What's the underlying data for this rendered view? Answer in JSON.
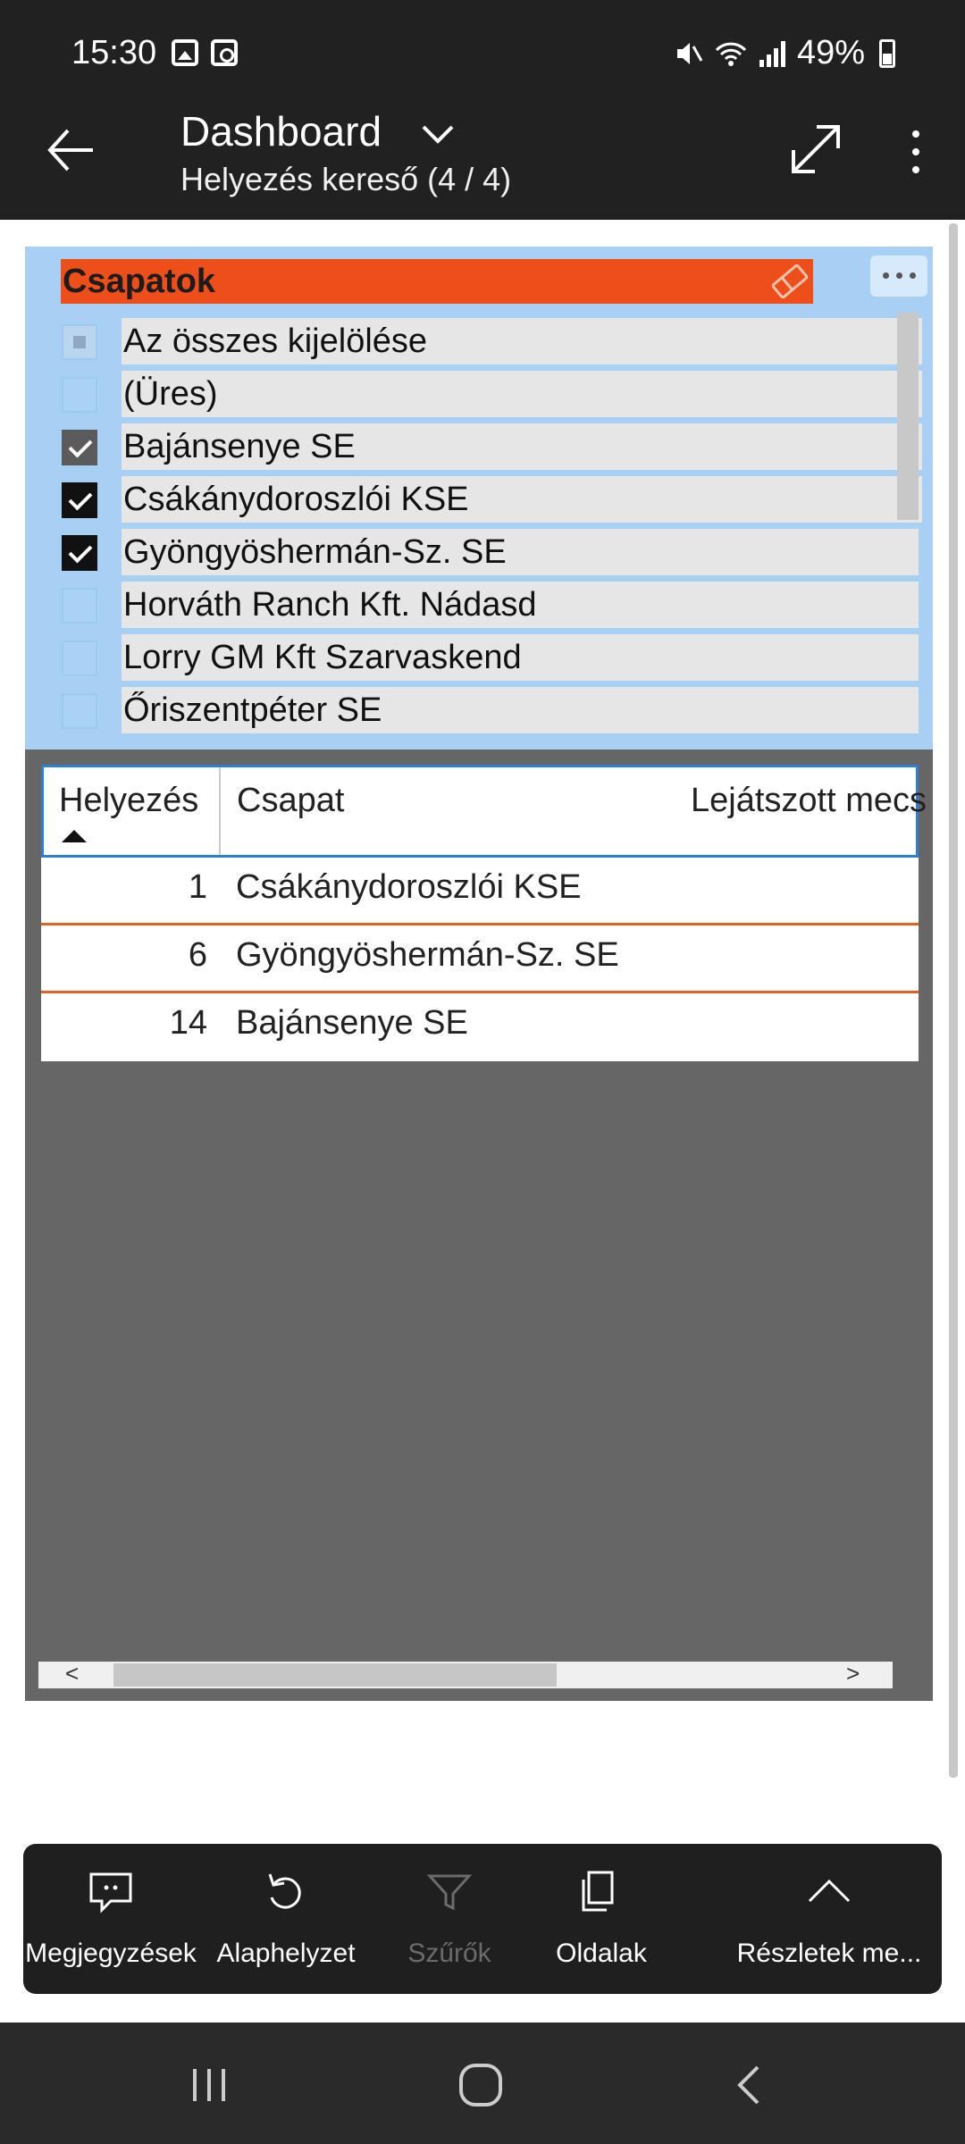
{
  "status_bar": {
    "time": "15:30",
    "battery": "49%",
    "icons": [
      "image-icon",
      "screenshot-icon",
      "mute-icon",
      "wifi-icon",
      "signal-icon",
      "battery-icon"
    ]
  },
  "app_bar": {
    "title": "Dashboard",
    "subtitle": "Helyezés kereső (4 / 4)"
  },
  "slicer": {
    "title": "Csapatok",
    "items": [
      {
        "label": "Az összes kijelölése",
        "state": "partial"
      },
      {
        "label": "(Üres)",
        "state": "unchecked"
      },
      {
        "label": "Bajánsenye SE",
        "state": "checked"
      },
      {
        "label": "Csákánydoroszlói KSE",
        "state": "checked"
      },
      {
        "label": "Gyöngyöshermán-Sz. SE",
        "state": "checked"
      },
      {
        "label": "Horváth Ranch Kft. Nádasd",
        "state": "unchecked"
      },
      {
        "label": "Lorry GM Kft Szarvaskend",
        "state": "unchecked"
      },
      {
        "label": "Őriszentpéter SE",
        "state": "unchecked"
      }
    ]
  },
  "table": {
    "columns": [
      "Helyezés",
      "Csapat",
      "Lejátszott mecs"
    ],
    "rows": [
      {
        "rank": "1",
        "team": "Csákánydoroszlói KSE"
      },
      {
        "rank": "6",
        "team": "Gyöngyöshermán-Sz. SE"
      },
      {
        "rank": "14",
        "team": "Bajánsenye SE"
      }
    ]
  },
  "toolbar": {
    "buttons": [
      {
        "label": "Megjegyzések",
        "icon": "comment-icon"
      },
      {
        "label": "Alaphelyzet",
        "icon": "reset-icon"
      },
      {
        "label": "Szűrők",
        "icon": "filter-icon",
        "disabled": true
      },
      {
        "label": "Oldalak",
        "icon": "pages-icon"
      },
      {
        "label": "Részletek me...",
        "icon": "chevron-up-icon"
      }
    ]
  },
  "colors": {
    "bar_bg": "#212121",
    "slicer_bg": "#a8d0f5",
    "slicer_header": "#ee4f1a",
    "canvas_bg": "#666666",
    "row_divider": "#e8601f",
    "header_border": "#2d7fd6"
  }
}
